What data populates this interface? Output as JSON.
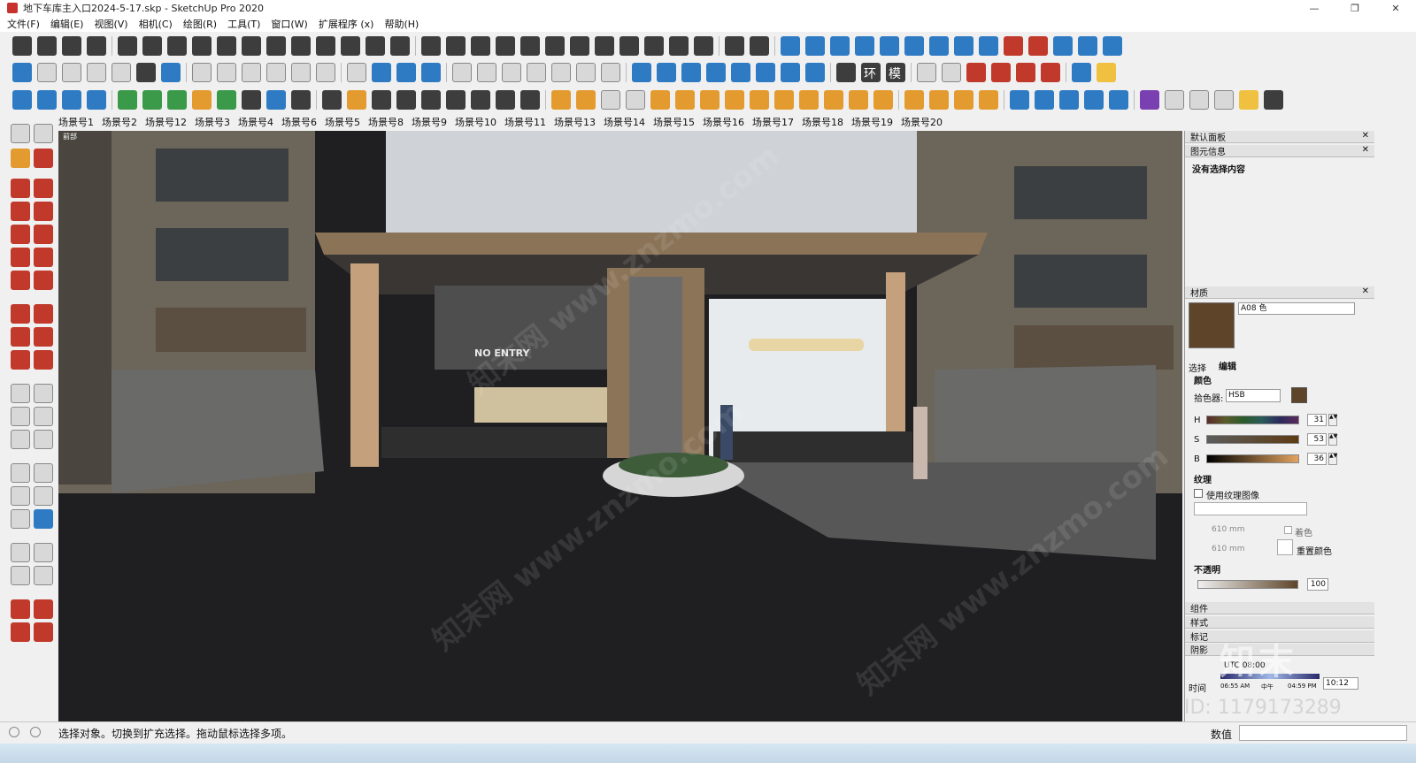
{
  "window": {
    "title": "地下车库主入口2024-5-17.skp - SketchUp Pro 2020",
    "minimize": "—",
    "maximize": "❐",
    "close": "✕"
  },
  "menu": [
    "文件(F)",
    "编辑(E)",
    "视图(V)",
    "相机(C)",
    "绘图(R)",
    "工具(T)",
    "窗口(W)",
    "扩展程序 (x)",
    "帮助(H)"
  ],
  "scenes": [
    "场景号1",
    "场景号2",
    "场景号12",
    "场景号3",
    "场景号4",
    "场景号6",
    "场景号5",
    "场景号8",
    "场景号9",
    "场景号10",
    "场景号11",
    "场景号13",
    "场景号14",
    "场景号15",
    "场景号16",
    "场景号17",
    "场景号18",
    "场景号19",
    "场景号20"
  ],
  "toolbar_text": {
    "mo_button": "模",
    "huan_button": "环",
    "mo2_button": "模"
  },
  "viewport": {
    "tab_label": "前部",
    "sign_text": "NO ENTRY",
    "watermark": "知末网 www.znzmo.com"
  },
  "panel": {
    "tray_title": "默认面板",
    "entity_info": {
      "title": "图元信息",
      "value": "没有选择内容"
    },
    "materials": {
      "title": "材质",
      "name": "A08 色",
      "swatch_color": "#5e4529",
      "tabs": [
        "选择",
        "编辑"
      ],
      "color_label": "颜色",
      "picker_label": "拾色器:",
      "picker_value": "HSB",
      "hsb": [
        {
          "label": "H",
          "value": "31"
        },
        {
          "label": "S",
          "value": "53"
        },
        {
          "label": "B",
          "value": "36"
        }
      ],
      "texture_label": "纹理",
      "use_texture": "使用纹理图像",
      "width": "610 mm",
      "height": "610 mm",
      "colorize": "着色",
      "reset_color": "重置颜色",
      "opacity_label": "不透明",
      "opacity_value": "100"
    },
    "collapsed": [
      "组件",
      "样式",
      "标记"
    ],
    "shadows": {
      "title": "阴影",
      "utc": "UTC 08:00",
      "time_label": "时间",
      "time_start": "06:55 AM",
      "noon": "中午",
      "time_end": "04:59 PM",
      "time_value": "10:12"
    }
  },
  "status": {
    "message": "选择对象。切换到扩充选择。拖动鼠标选择多项。",
    "value_label": "数值"
  },
  "overlay": {
    "brand": "知末",
    "id": "ID: 1179173289"
  }
}
